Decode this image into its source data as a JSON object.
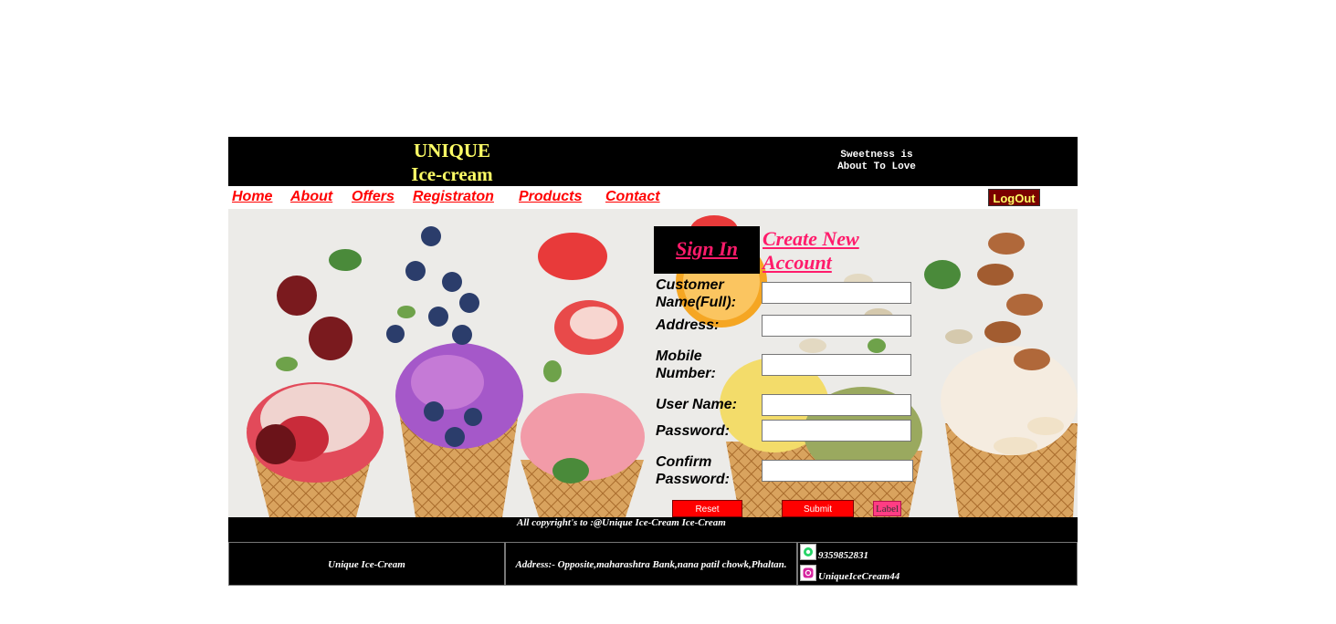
{
  "header": {
    "brand_line1": "UNIQUE",
    "brand_line2": "Ice-cream",
    "tagline_line1": "Sweetness is",
    "tagline_line2": "About To Love"
  },
  "nav": {
    "items": [
      "Home",
      "About",
      "Offers",
      "Registraton",
      "Products",
      "Contact"
    ],
    "logout_label": "LogOut"
  },
  "form": {
    "signin_label": "Sign In",
    "create_line1": "Create New",
    "create_line2": "Account",
    "fields": {
      "customer_name_line1": "Customer",
      "customer_name_line2": "Name(Full):",
      "address": "Address:",
      "mobile_line1": "Mobile",
      "mobile_line2": "Number:",
      "username": "User Name:",
      "password": "Password:",
      "confirm_line1": "Confirm",
      "confirm_line2": "Password:"
    },
    "reset_label": "Reset",
    "submit_label": "Submit",
    "label_button": "Label"
  },
  "footer": {
    "copyright": "All copyright's to :@Unique Ice-Cream Ice-Cream",
    "company": "Unique Ice-Cream",
    "address": "Address:- Opposite,maharashtra Bank,nana patil chowk,Phaltan.",
    "phone": "9359852831",
    "instagram": "UniqueIceCream44"
  },
  "colors": {
    "header_bg": "#000000",
    "brand_text": "#ffff66",
    "nav_link": "#ff0000",
    "form_link": "#ff1b6b",
    "button_red": "#ff0000",
    "logout_bg": "#7a0000"
  },
  "icons": {
    "whatsapp": "whatsapp-icon",
    "instagram": "instagram-icon"
  }
}
